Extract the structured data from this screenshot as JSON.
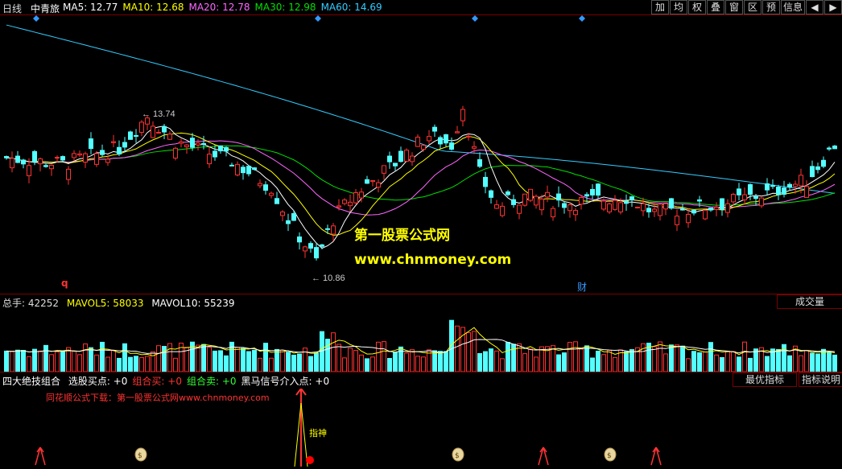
{
  "header": {
    "period": "日线",
    "stock_name": "中青旅",
    "ma": [
      {
        "label": "MA5: ",
        "value": "12.77",
        "color": "#ffffff"
      },
      {
        "label": "MA10: ",
        "value": "12.68",
        "color": "#ffff00"
      },
      {
        "label": "MA20: ",
        "value": "12.78",
        "color": "#ff66ff"
      },
      {
        "label": "MA30: ",
        "value": "12.98",
        "color": "#00e000"
      },
      {
        "label": "MA60: ",
        "value": "14.69",
        "color": "#33ccff"
      }
    ]
  },
  "toolbar": {
    "buttons": [
      "加",
      "均",
      "权",
      "叠",
      "窗",
      "区",
      "预",
      "信息"
    ],
    "arrow_left": "◀",
    "arrow_right": "▶"
  },
  "main_chart": {
    "high_label": "13.74",
    "low_label": "10.86",
    "watermark_title": "第一股票公式网",
    "watermark_url": "www.chnmoney.com",
    "marker_q": "q",
    "marker_cai": "财"
  },
  "volume": {
    "label": "总手: ",
    "value": "42252",
    "mavol5_label": "MAVOL5: ",
    "mavol5_value": "58033",
    "mavol10_label": "MAVOL10: ",
    "mavol10_value": "55239",
    "tab": "成交量"
  },
  "indicator": {
    "title": "四大绝技组合",
    "items": [
      {
        "label": "选股买点: ",
        "value": "+0",
        "color": "#ffffff"
      },
      {
        "label": "组合买: ",
        "value": "+0",
        "color": "#ff3333"
      },
      {
        "label": "组合卖: ",
        "value": "+0",
        "color": "#33ff33"
      },
      {
        "label": "黑马信号介入点: ",
        "value": "+0",
        "color": "#ffffff"
      }
    ],
    "btn_best": "最优指标",
    "btn_help": "指标说明",
    "source_text": "同花顺公式下载：第一股票公式网www.chnmoney.com",
    "signal_label": "指神"
  },
  "colors": {
    "up": "#ff3232",
    "down": "#54ffff",
    "border": "#7a0000"
  }
}
